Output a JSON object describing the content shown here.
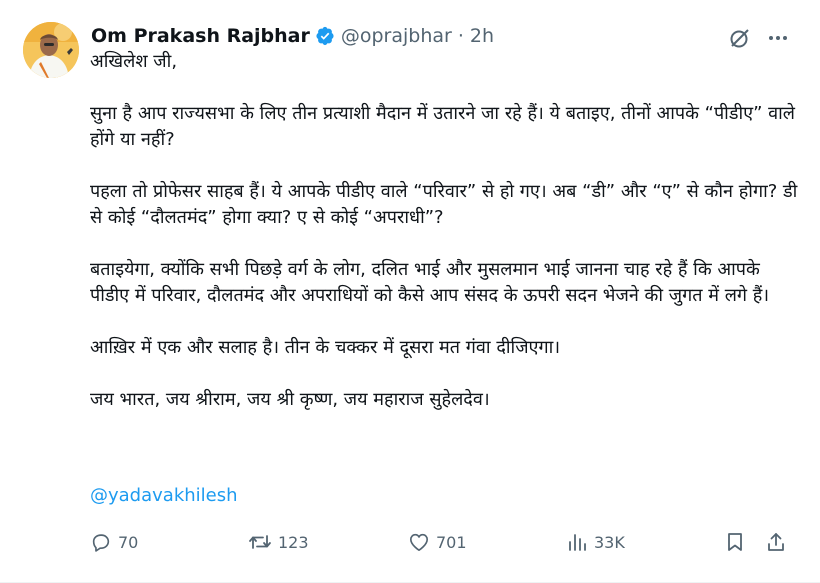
{
  "author": {
    "name": "Om Prakash Rajbhar",
    "handle": "@oprajbhar",
    "separator": "·",
    "time": "2h"
  },
  "paragraphs": [
    "अखिलेश जी,",
    "सुना है आप राज्यसभा के लिए तीन प्रत्याशी मैदान में उतारने जा रहे हैं। ये बताइए, तीनों आपके “पीडीए” वाले होंगे या नहीं?",
    "पहला तो प्रोफेसर साहब हैं। ये आपके पीडीए वाले “परिवार” से हो गए। अब “डी” और “ए” से कौन होगा? डी से कोई “दौलतमंद” होगा क्या? ए से कोई “अपराधी”?",
    "बताइयेगा, क्योंकि सभी पिछड़े वर्ग के लोग, दलित भाई और मुसलमान भाई जानना चाह रहे हैं कि आपके पीडीए में परिवार, दौलतमंद और अपराधियों को कैसे आप संसद के ऊपरी सदन भेजने की जुगत में लगे हैं।",
    "आख़िर में एक और सलाह है। तीन के चक्कर में दूसरा मत गंवा दीजिएगा।",
    "जय भारत, जय श्रीराम, जय श्री कृष्ण, जय महाराज सुहेलदेव।"
  ],
  "mention": "@yadavakhilesh",
  "metrics": {
    "replies": "70",
    "reposts": "123",
    "likes": "701",
    "views": "33K"
  },
  "colors": {
    "accent": "#1d9bf0",
    "secondary_text": "#536471",
    "primary_text": "#0f1419"
  },
  "icons": {
    "verified": "verified-badge-icon",
    "grok": "grok-icon",
    "more": "more-icon",
    "reply": "reply-icon",
    "repost": "repost-icon",
    "like": "like-icon",
    "views": "views-icon",
    "bookmark": "bookmark-icon",
    "share": "share-icon"
  }
}
